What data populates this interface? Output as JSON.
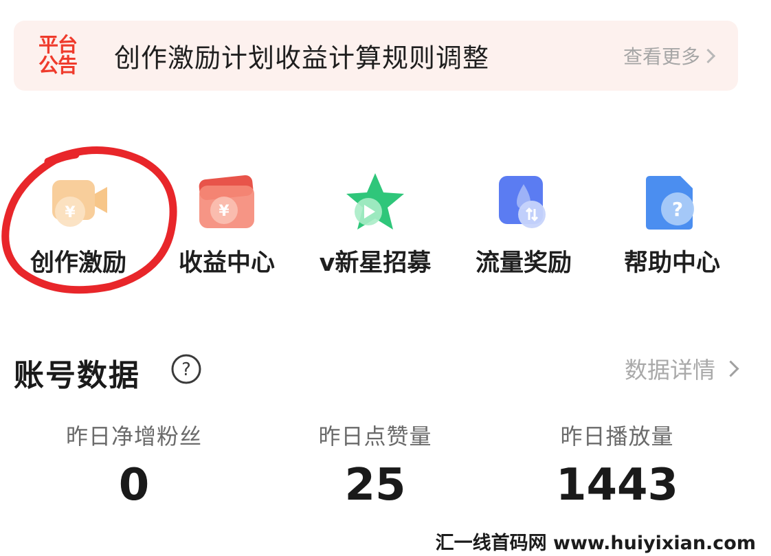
{
  "banner": {
    "tag": "平台公告",
    "title": "创作激励计划收益计算规则调整",
    "more_label": "查看更多"
  },
  "menu": {
    "items": [
      {
        "label": "创作激励",
        "icon": "video-camera-yuan-icon",
        "color": "#f5b86b"
      },
      {
        "label": "收益中心",
        "icon": "wallet-yuan-icon",
        "color": "#f26b5b"
      },
      {
        "label": "v新星招募",
        "icon": "star-play-icon",
        "color": "#2fc67a"
      },
      {
        "label": "流量奖励",
        "icon": "traffic-drop-icon",
        "color": "#5b7cf2"
      },
      {
        "label": "帮助中心",
        "icon": "help-document-icon",
        "color": "#4b8ef0"
      }
    ]
  },
  "account": {
    "title": "账号数据",
    "detail_label": "数据详情",
    "stats": [
      {
        "label": "昨日净增粉丝",
        "value": "0"
      },
      {
        "label": "昨日点赞量",
        "value": "25"
      },
      {
        "label": "昨日播放量",
        "value": "1443"
      }
    ]
  },
  "watermark": "汇一线首码网 www.huiyixian.com",
  "colors": {
    "accent_red": "#ef3b2c",
    "banner_bg": "#fdf1ee",
    "annotation_circle": "#e8262a"
  }
}
